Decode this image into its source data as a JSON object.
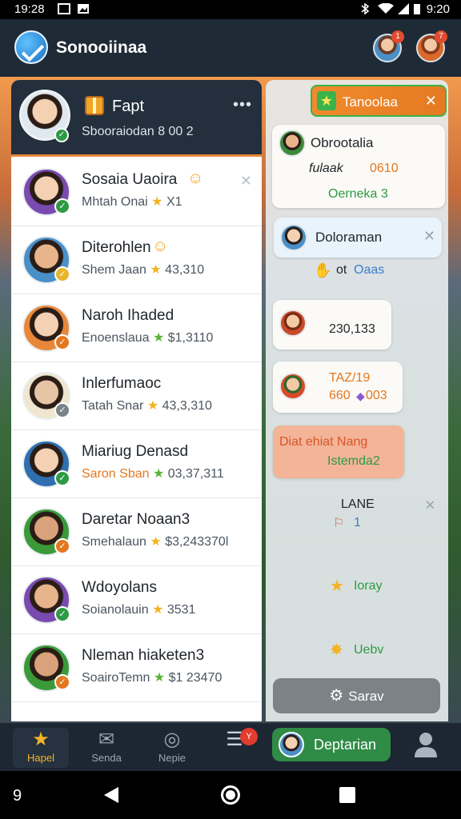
{
  "status_bar": {
    "time": "19:28",
    "clock": "9:20"
  },
  "header": {
    "title": "Sonooiinaa",
    "badge_1": "1",
    "badge_2": "7"
  },
  "profile": {
    "name": "Fapt",
    "stats": "Sbooraiodan  8 00  2",
    "more": "•••"
  },
  "friends": [
    {
      "name": "Sosaia Uaoira",
      "meta_prefix": "Mhtah Onai",
      "meta_value": "X1",
      "check": "green",
      "emoji": true,
      "close": true
    },
    {
      "name": "Diterohlen",
      "meta_prefix": "Shem Jaan",
      "meta_value": "43,310",
      "check": "yellow",
      "emoji": true
    },
    {
      "name": "Naroh Ihaded",
      "meta_prefix": "Enoenslaua",
      "meta_value": "$1,3110",
      "check": "orange",
      "star": "green"
    },
    {
      "name": "Inlerfumaoc",
      "meta_prefix": "Tatah Snar",
      "meta_value": "43,3,310",
      "check": "gray"
    },
    {
      "name": "Miariug Denasd",
      "meta_prefix": "Saron Sban",
      "meta_value": "03,37,311",
      "check": "green",
      "orange_prefix": true,
      "star": "green"
    },
    {
      "name": "Daretar Noaan3",
      "meta_prefix": "Smehalaun",
      "meta_value": "$3,243370l",
      "check": "orange"
    },
    {
      "name": "Wdoyolans",
      "meta_prefix": "Soianolauin",
      "meta_value": "3531",
      "check": "green"
    },
    {
      "name": "Nleman hiaketen3",
      "meta_prefix": "SoairoTemn",
      "meta_value": "$1 23470",
      "check": "orange",
      "star": "green"
    }
  ],
  "chat": {
    "tab_label": "Tanoolaa",
    "b1": {
      "name": "Obrootalia",
      "line": "fulaak",
      "value": "0610",
      "sub": "Oerneka 3"
    },
    "b2": {
      "name": "Doloraman"
    },
    "b2_reply": {
      "text": "ot",
      "link": "Oaas"
    },
    "b3": {
      "value": "230,133"
    },
    "b4": {
      "line1": "TAZ/19",
      "line2": "660",
      "line2b": "003"
    },
    "b5": {
      "line1": "Diat ehiat Nang",
      "line2": "Istemda2"
    },
    "b6": {
      "title": "LANE",
      "count": "1"
    },
    "b7": {
      "label": "Ioray"
    },
    "b8": {
      "label": "Uebv"
    },
    "save_label": "Sarav"
  },
  "nav": {
    "items": [
      {
        "label": "Hapel"
      },
      {
        "label": "Senda"
      },
      {
        "label": "Nepie"
      }
    ],
    "badge": "Y",
    "pill_label": "Deptarian"
  },
  "system_nav": {
    "num": "9"
  },
  "colors": {
    "accent_orange": "#e8873a",
    "online_green": "#2e9a43",
    "star_yellow": "#f3b322",
    "nav_bg": "#1d2733"
  }
}
